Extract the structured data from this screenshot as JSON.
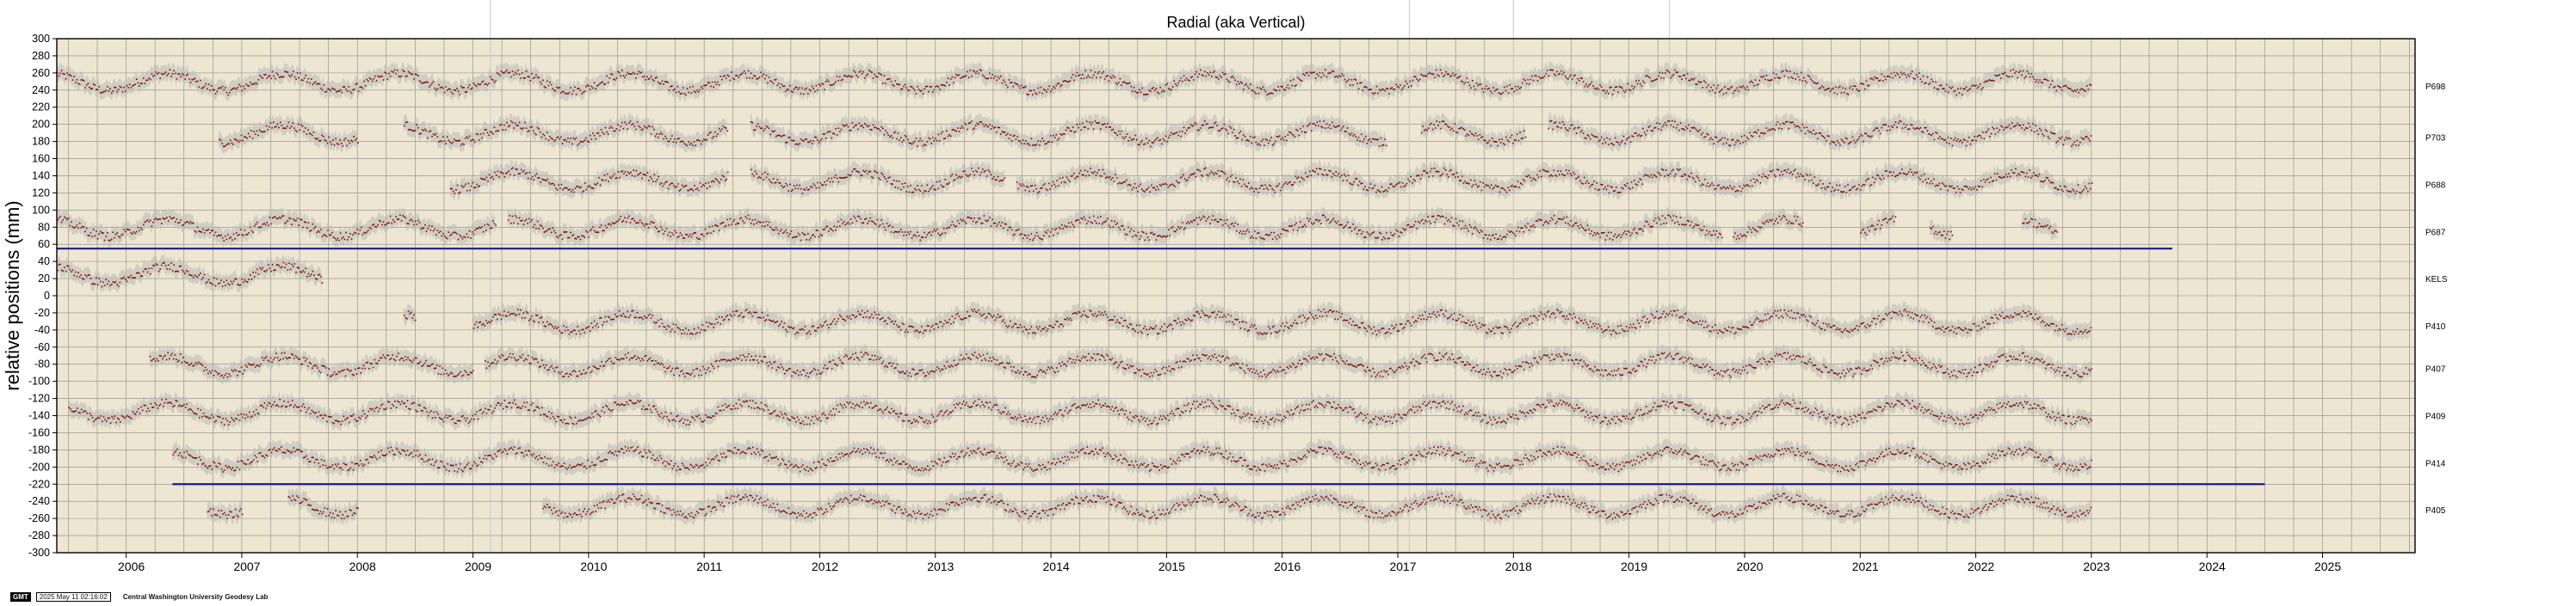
{
  "chart_data": {
    "type": "scatter",
    "title": "Radial (aka Vertical)",
    "ylabel": "relative positions (mm)",
    "xlabel": "",
    "xlim": [
      2005.4,
      2025.8
    ],
    "ylim": [
      -300,
      300
    ],
    "grid": true,
    "x_ticks": [
      2006,
      2007,
      2008,
      2009,
      2010,
      2011,
      2012,
      2013,
      2014,
      2015,
      2016,
      2017,
      2018,
      2019,
      2020,
      2021,
      2022,
      2023,
      2024,
      2025
    ],
    "y_ticks": [
      300,
      280,
      260,
      240,
      220,
      200,
      180,
      160,
      140,
      120,
      100,
      80,
      60,
      40,
      20,
      0,
      -20,
      -40,
      -60,
      -80,
      -100,
      -120,
      -140,
      -160,
      -180,
      -200,
      -220,
      -240,
      -260,
      -280,
      -300
    ],
    "colors": {
      "plot_background": "#ede6d2",
      "grid": "#8a8a80",
      "points": "#7a0d0d",
      "error_band": "#b8b8b4",
      "reference_line": "#1a1a8c"
    },
    "series": [
      {
        "name": "P698",
        "offset_mm": 250,
        "segments": [
          [
            2005.4,
            2023.0
          ]
        ]
      },
      {
        "name": "P703",
        "offset_mm": 190,
        "segments": [
          [
            2006.8,
            2008.0
          ],
          [
            2008.4,
            2011.2
          ],
          [
            2011.4,
            2016.9
          ],
          [
            2017.2,
            2018.1
          ],
          [
            2018.3,
            2023.0
          ]
        ]
      },
      {
        "name": "P688",
        "offset_mm": 135,
        "segments": [
          [
            2008.8,
            2011.2
          ],
          [
            2011.4,
            2013.6
          ],
          [
            2013.7,
            2023.0
          ]
        ]
      },
      {
        "name": "P687",
        "offset_mm": 80,
        "segments": [
          [
            2005.4,
            2009.2
          ],
          [
            2009.3,
            2019.8
          ],
          [
            2019.9,
            2020.5
          ],
          [
            2021.0,
            2021.3
          ],
          [
            2021.6,
            2021.8
          ],
          [
            2022.4,
            2022.7
          ]
        ]
      },
      {
        "name": "KELS",
        "offset_mm": 25,
        "segments": [
          [
            2005.4,
            2007.7
          ]
        ]
      },
      {
        "name": "P410",
        "offset_mm": -30,
        "segments": [
          [
            2008.4,
            2008.5
          ],
          [
            2009.0,
            2023.0
          ]
        ]
      },
      {
        "name": "P407",
        "offset_mm": -80,
        "segments": [
          [
            2006.2,
            2009.0
          ],
          [
            2009.1,
            2023.0
          ]
        ]
      },
      {
        "name": "P409",
        "offset_mm": -135,
        "segments": [
          [
            2005.5,
            2023.0
          ]
        ]
      },
      {
        "name": "P414",
        "offset_mm": -190,
        "segments": [
          [
            2006.4,
            2023.0
          ]
        ]
      },
      {
        "name": "P405",
        "offset_mm": -245,
        "segments": [
          [
            2006.7,
            2007.0
          ],
          [
            2007.4,
            2008.0
          ],
          [
            2009.6,
            2023.0
          ]
        ]
      }
    ],
    "reference_lines": [
      {
        "y": 55,
        "x_range": [
          2005.4,
          2023.7
        ]
      },
      {
        "y": -220,
        "x_range": [
          2006.4,
          2024.5
        ]
      }
    ],
    "vertical_markers": [
      2009.15,
      2017.1,
      2018.0,
      2019.35
    ]
  },
  "footer": {
    "badge": "GMT",
    "timestamp": "2025 May 11 02:16:02",
    "credit": "Central Washington University Geodesy Lab"
  }
}
